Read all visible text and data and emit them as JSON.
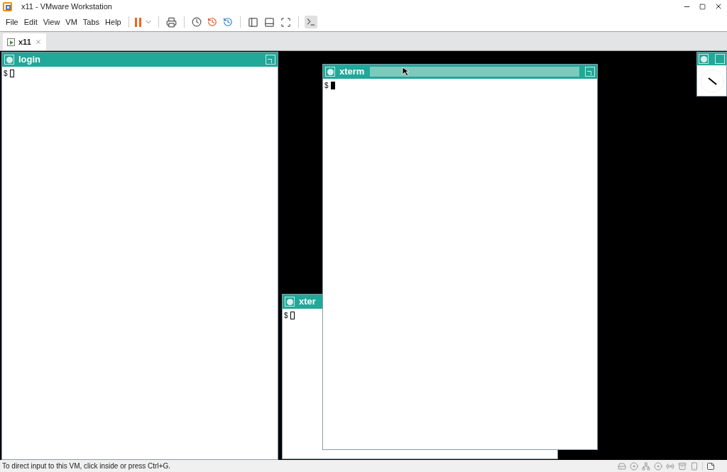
{
  "window": {
    "title": "x11 - VMware Workstation"
  },
  "menu": [
    "File",
    "Edit",
    "View",
    "VM",
    "Tabs",
    "Help"
  ],
  "tabs": [
    {
      "label": "x11",
      "selected": true
    }
  ],
  "vm_windows": [
    {
      "title": "login",
      "prompt": "$",
      "focused": false
    },
    {
      "title": "xter",
      "prompt": "$",
      "focused": false
    },
    {
      "title": "xterm",
      "prompt": "$",
      "focused": true
    }
  ],
  "status_bar": {
    "message": "To direct input to this VM, click inside or press Ctrl+G."
  }
}
